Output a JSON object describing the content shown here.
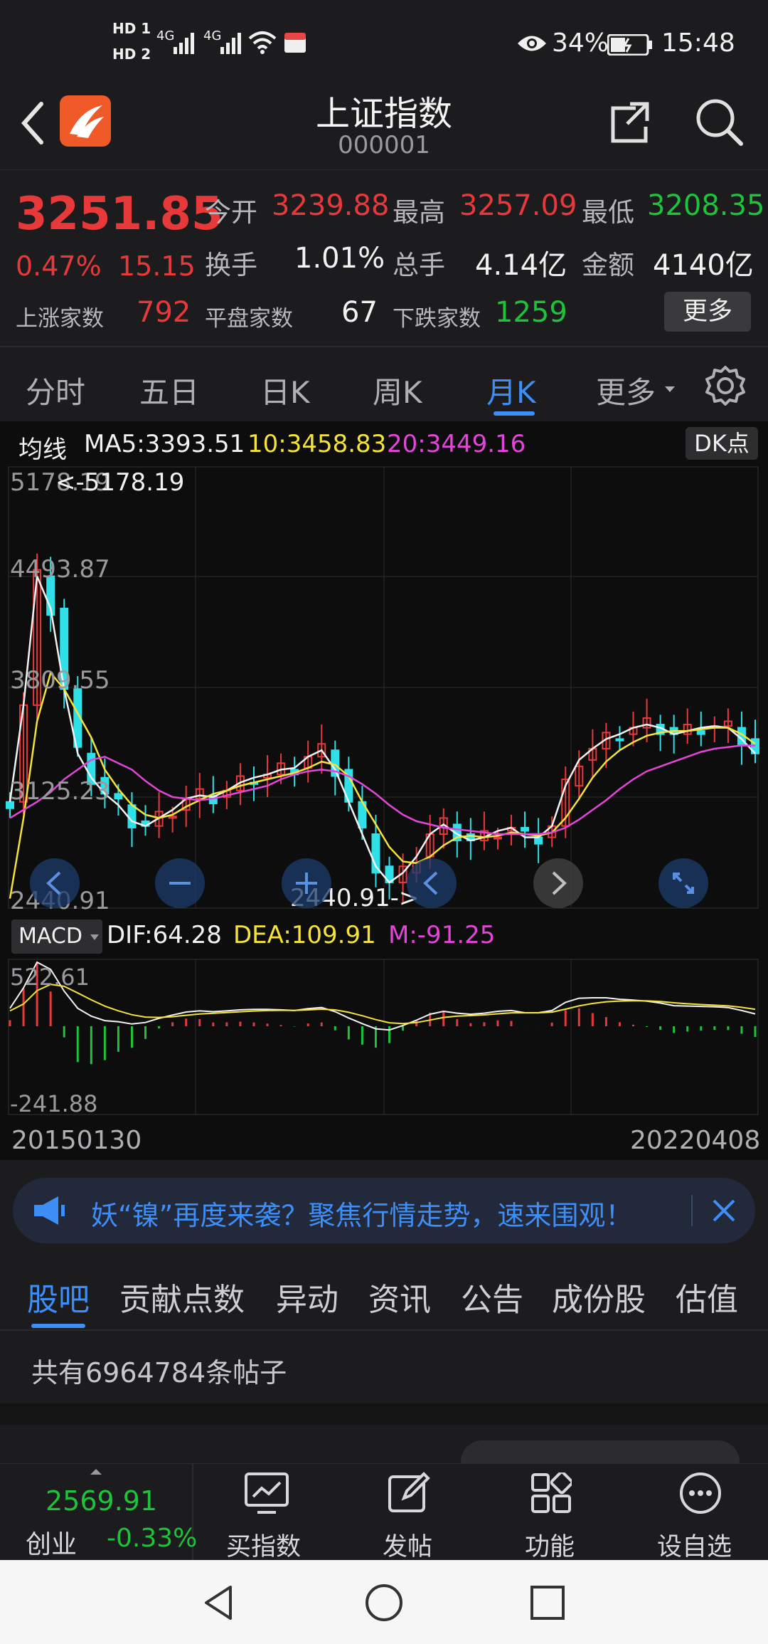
{
  "status": {
    "time": "15:48",
    "battery": "34%",
    "signal1": "4G",
    "signal2": "4G",
    "hd1": "HD 1",
    "hd2": "HD 2"
  },
  "header": {
    "title": "上证指数",
    "code": "000001"
  },
  "quote": {
    "price": "3251.85",
    "change_pct": "0.47%",
    "change_abs": "15.15",
    "open_label": "今开",
    "open": "3239.88",
    "high_label": "最高",
    "high": "3257.09",
    "low_label": "最低",
    "low": "3208.35",
    "turnover_label": "换手",
    "turnover": "1.01%",
    "volume_label": "总手",
    "volume": "4.14亿",
    "amount_label": "金额",
    "amount": "4140亿",
    "up_label": "上涨家数",
    "up": "792",
    "flat_label": "平盘家数",
    "flat": "67",
    "down_label": "下跌家数",
    "down": "1259",
    "more_button": "更多",
    "colors": {
      "up": "#e8393a",
      "down": "#1fc23b"
    }
  },
  "tabs": {
    "items": [
      "分时",
      "五日",
      "日K",
      "周K",
      "月K",
      "更多"
    ],
    "active": "月K"
  },
  "ma": {
    "label": "均线",
    "ma5": "MA5:3393.51",
    "ma10": "10:3458.83",
    "ma20": "20:3449.16",
    "dk_button": "DK点"
  },
  "price_axis": [
    "5178.19",
    "4493.87",
    "3809.55",
    "3125.23",
    "2440.91"
  ],
  "max_marker": "<-5178.19",
  "min_marker": "2440.91->",
  "macd": {
    "selector": "MACD",
    "dif": "DIF:64.28",
    "dea": "DEA:109.91",
    "m": "M:-91.25",
    "axis_top": "522.61",
    "axis_bottom": "-241.88"
  },
  "date_range": {
    "start": "20150130",
    "end": "20220408"
  },
  "banner": {
    "text": "妖“镍”再度来袭？聚焦行情走势，速来围观！"
  },
  "subtabs": {
    "items": [
      "股吧",
      "贡献点数",
      "异动",
      "资讯",
      "公告",
      "成份股",
      "估值"
    ],
    "active": "股吧"
  },
  "posts": {
    "count_text": "共有6964784条帖子"
  },
  "bottomnav": {
    "index_value": "2569.91",
    "index_name": "创业",
    "index_change": "-0.33%",
    "items": [
      "买指数",
      "发帖",
      "功能",
      "设自选"
    ]
  },
  "chart_data": {
    "type": "candlestick",
    "title": "上证指数 月K",
    "y_range": [
      2440.91,
      5178.19
    ],
    "x_range": [
      "20150130",
      "20220408"
    ],
    "series": [
      {
        "name": "MA5",
        "color": "#f2f2f2",
        "values": [
          3100,
          3700,
          4500,
          4300,
          3800,
          3400,
          3250,
          3150,
          3080,
          2980,
          2950,
          3000,
          3050,
          3120,
          3140,
          3130,
          3170,
          3220,
          3250,
          3270,
          3300,
          3310,
          3380,
          3420,
          3300,
          3100,
          2900,
          2700,
          2600,
          2660,
          2760,
          2900,
          2960,
          2900,
          2860,
          2880,
          2920,
          2940,
          2880,
          2880,
          2950,
          3200,
          3360,
          3430,
          3490,
          3520,
          3560,
          3580,
          3560,
          3520,
          3540,
          3560,
          3570,
          3560,
          3490,
          3400
        ]
      },
      {
        "name": "MA10",
        "color": "#f5e23b",
        "values": [
          2500,
          3000,
          3600,
          3900,
          3800,
          3650,
          3500,
          3300,
          3180,
          3080,
          3020,
          3000,
          3020,
          3070,
          3110,
          3150,
          3170,
          3200,
          3220,
          3240,
          3260,
          3280,
          3310,
          3350,
          3330,
          3260,
          3100,
          2960,
          2820,
          2730,
          2720,
          2760,
          2830,
          2880,
          2890,
          2880,
          2890,
          2910,
          2900,
          2890,
          2910,
          3000,
          3120,
          3250,
          3350,
          3420,
          3470,
          3510,
          3530,
          3540,
          3540,
          3550,
          3560,
          3560,
          3520,
          3460
        ]
      },
      {
        "name": "MA20",
        "color": "#e445d9",
        "values": [
          3000,
          3050,
          3100,
          3160,
          3240,
          3300,
          3360,
          3380,
          3340,
          3300,
          3230,
          3170,
          3130,
          3120,
          3110,
          3120,
          3140,
          3160,
          3180,
          3200,
          3240,
          3270,
          3290,
          3300,
          3290,
          3260,
          3210,
          3150,
          3080,
          3020,
          2980,
          2960,
          2940,
          2930,
          2920,
          2910,
          2900,
          2900,
          2900,
          2900,
          2910,
          2940,
          2990,
          3050,
          3110,
          3180,
          3240,
          3290,
          3320,
          3350,
          3380,
          3410,
          3430,
          3440,
          3450,
          3449
        ]
      }
    ]
  }
}
